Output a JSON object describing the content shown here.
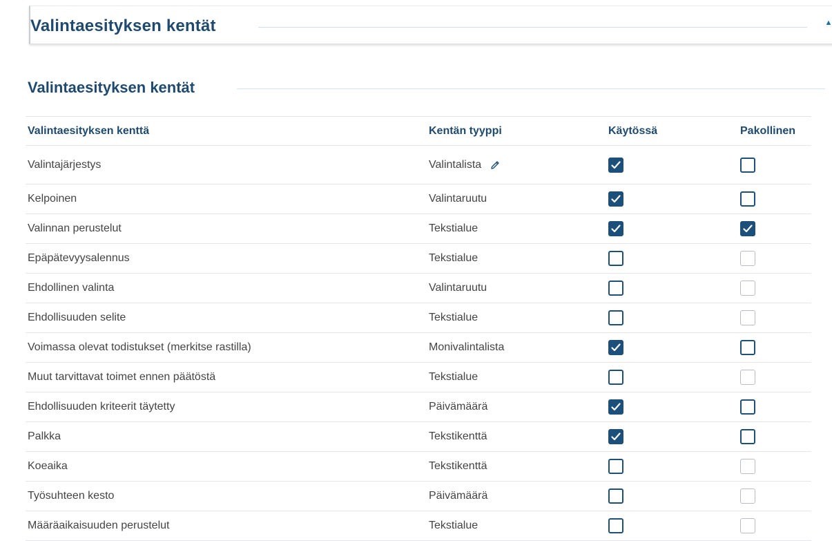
{
  "panel": {
    "title": "Valintaesityksen kentät",
    "toggle_icon": "chevron-up-icon"
  },
  "section": {
    "title": "Valintaesityksen kentät"
  },
  "table": {
    "headers": [
      "Valintaesityksen kenttä",
      "Kentän tyyppi",
      "Käytössä",
      "Pakollinen"
    ],
    "rows": [
      {
        "field": "Valintajärjestys",
        "type": "Valintalista",
        "editable": true,
        "enabled": true,
        "required": false,
        "required_disabled": false
      },
      {
        "field": "Kelpoinen",
        "type": "Valintaruutu",
        "editable": false,
        "enabled": true,
        "required": false,
        "required_disabled": false
      },
      {
        "field": "Valinnan perustelut",
        "type": "Tekstialue",
        "editable": false,
        "enabled": true,
        "required": true,
        "required_disabled": false
      },
      {
        "field": "Epäpätevyysalennus",
        "type": "Tekstialue",
        "editable": false,
        "enabled": false,
        "required": false,
        "required_disabled": true
      },
      {
        "field": "Ehdollinen valinta",
        "type": "Valintaruutu",
        "editable": false,
        "enabled": false,
        "required": false,
        "required_disabled": true
      },
      {
        "field": "Ehdollisuuden selite",
        "type": "Tekstialue",
        "editable": false,
        "enabled": false,
        "required": false,
        "required_disabled": true
      },
      {
        "field": "Voimassa olevat todistukset (merkitse rastilla)",
        "type": "Monivalintalista",
        "editable": false,
        "enabled": true,
        "required": false,
        "required_disabled": false
      },
      {
        "field": "Muut tarvittavat toimet ennen päätöstä",
        "type": "Tekstialue",
        "editable": false,
        "enabled": false,
        "required": false,
        "required_disabled": true
      },
      {
        "field": "Ehdollisuuden kriteerit täytetty",
        "type": "Päivämäärä",
        "editable": false,
        "enabled": true,
        "required": false,
        "required_disabled": false
      },
      {
        "field": "Palkka",
        "type": "Tekstikenttä",
        "editable": false,
        "enabled": true,
        "required": false,
        "required_disabled": false
      },
      {
        "field": "Koeaika",
        "type": "Tekstikenttä",
        "editable": false,
        "enabled": false,
        "required": false,
        "required_disabled": true
      },
      {
        "field": "Työsuhteen kesto",
        "type": "Päivämäärä",
        "editable": false,
        "enabled": false,
        "required": false,
        "required_disabled": true
      },
      {
        "field": "Määräaikaisuuden perustelut",
        "type": "Tekstialue",
        "editable": false,
        "enabled": false,
        "required": false,
        "required_disabled": true
      }
    ]
  },
  "colors": {
    "primary": "#1c4f7a",
    "heading": "#1f4a6e",
    "disabled_border": "#b9bdc2"
  }
}
